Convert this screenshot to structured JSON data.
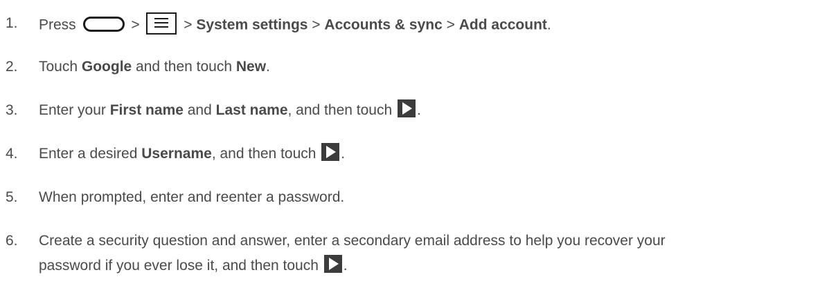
{
  "steps": [
    {
      "num": "1.",
      "t0": "Press",
      "t1": " > ",
      "t2": " > ",
      "b1": "System settings",
      "t3": " > ",
      "b2": "Accounts & sync",
      "t4": " > ",
      "b3": "Add account",
      "t5": "."
    },
    {
      "num": "2.",
      "t0": "Touch ",
      "b1": "Google",
      "t1": " and then touch ",
      "b2": "New",
      "t2": "."
    },
    {
      "num": "3.",
      "t0": "Enter your ",
      "b1": "First name",
      "t1": " and ",
      "b2": "Last name",
      "t2": ", and then touch ",
      "t3": "."
    },
    {
      "num": "4.",
      "t0": "Enter a desired ",
      "b1": "Username",
      "t1": ", and then touch ",
      "t2": "."
    },
    {
      "num": "5.",
      "t0": "When prompted, enter and reenter a password."
    },
    {
      "num": "6.",
      "line1": "Create a security question and answer, enter a secondary email address to help you recover your",
      "line2": "password if you ever lose it, and then touch ",
      "t_end": "."
    }
  ],
  "icons": {
    "home_key": "home-key-icon",
    "menu_key": "menu-key-icon",
    "next_button": "next-arrow-icon"
  }
}
